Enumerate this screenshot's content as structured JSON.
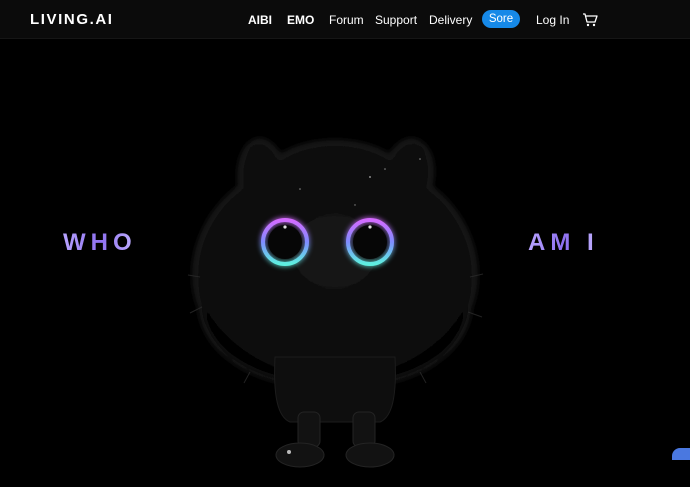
{
  "brand": {
    "logo_text": "LIVING.AI"
  },
  "nav": {
    "items": [
      {
        "label": "AIBI"
      },
      {
        "label": "EMO"
      },
      {
        "label": "Forum"
      },
      {
        "label": "Support"
      },
      {
        "label": "Delivery"
      }
    ],
    "store_label": "Sore",
    "login_label": "Log In",
    "cart_icon": "cart-icon"
  },
  "hero": {
    "left_text": "WHO",
    "right_text": "AM I"
  },
  "colors": {
    "accent": "#1689e8",
    "hero_text": "#9f86ff",
    "eye_ring_top": "#d46bff",
    "eye_ring_bottom": "#5ef0e0"
  }
}
